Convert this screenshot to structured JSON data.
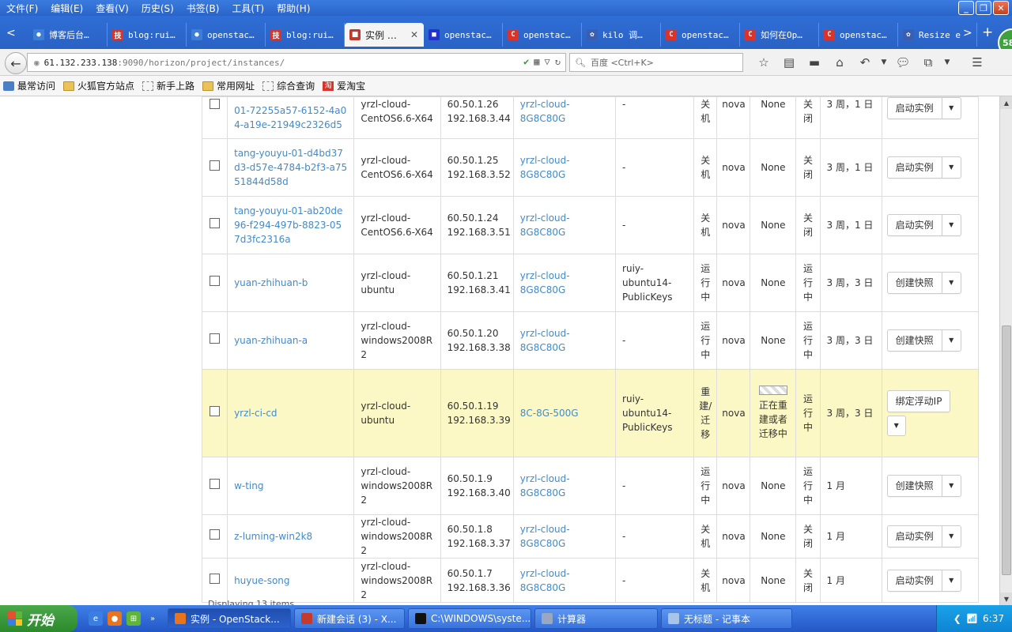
{
  "menu": [
    "文件(F)",
    "编辑(E)",
    "查看(V)",
    "历史(S)",
    "书签(B)",
    "工具(T)",
    "帮助(H)"
  ],
  "window_controls": {
    "minimize": "_",
    "maximize": "❐",
    "close": "✕"
  },
  "tabs": [
    {
      "label": "博客后台…",
      "icon_color": "#3d7fd6",
      "icon_char": "●"
    },
    {
      "label": "blog:rui…",
      "icon_color": "#d9342b",
      "icon_char": "技"
    },
    {
      "label": "openstac…",
      "icon_color": "#3d7fd6",
      "icon_char": "●"
    },
    {
      "label": "blog:rui…",
      "icon_color": "#d9342b",
      "icon_char": "技"
    },
    {
      "label": "实例 …",
      "icon_color": "#c0392b",
      "icon_char": "■",
      "active": true,
      "close": "✕"
    },
    {
      "label": "openstac…",
      "icon_color": "#2233cc",
      "icon_char": "■"
    },
    {
      "label": "openstac…",
      "icon_color": "#d9342b",
      "icon_char": "C"
    },
    {
      "label": "kilo 调…",
      "icon_color": "#3a5fb0",
      "icon_char": "✿"
    },
    {
      "label": "openstac…",
      "icon_color": "#d9342b",
      "icon_char": "C"
    },
    {
      "label": "如何在Op…",
      "icon_color": "#d9342b",
      "icon_char": "C"
    },
    {
      "label": "openstac…",
      "icon_color": "#d9342b",
      "icon_char": "C"
    },
    {
      "label": "Resize e",
      "icon_color": "#3a5fb0",
      "icon_char": "✿"
    }
  ],
  "tab_nav": {
    "prev": "<",
    "next": ">",
    "new": "+"
  },
  "profile_badge": "58",
  "url": {
    "host": "61.132.233.138",
    "rest": ":9090/horizon/project/instances/"
  },
  "search_placeholder": "百度 <Ctrl+K>",
  "bookmarks": [
    {
      "label": "最常访问",
      "icon": "search-icon"
    },
    {
      "label": "火狐官方站点",
      "icon": "folder-icon"
    },
    {
      "label": "新手上路",
      "icon": "dashed-page-icon"
    },
    {
      "label": "常用网址",
      "icon": "folder-icon"
    },
    {
      "label": "综合查询",
      "icon": "dashed-page-icon"
    },
    {
      "label": "爱淘宝",
      "icon": "taobao-icon"
    }
  ],
  "rows": [
    {
      "name": "01-72255a57-6152-4a04-a19e-21949c2326d5",
      "image": "yrzl-cloud-CentOS6.6-X64",
      "ip": "60.50.1.26 192.168.3.44",
      "flavor": "yrzl-cloud-8G8C80G",
      "keypair": "-",
      "status": "关机",
      "zone": "nova",
      "task": "None",
      "power": "关闭",
      "time": "3 周，1 日",
      "action": "启动实例",
      "partial_top": true
    },
    {
      "name": "tang-youyu-01-d4bd37d3-d57e-4784-b2f3-a7551844d58d",
      "image": "yrzl-cloud-CentOS6.6-X64",
      "ip": "60.50.1.25 192.168.3.52",
      "flavor": "yrzl-cloud-8G8C80G",
      "keypair": "-",
      "status": "关机",
      "zone": "nova",
      "task": "None",
      "power": "关闭",
      "time": "3 周，1 日",
      "action": "启动实例"
    },
    {
      "name": "tang-youyu-01-ab20de96-f294-497b-8823-057d3fc2316a",
      "image": "yrzl-cloud-CentOS6.6-X64",
      "ip": "60.50.1.24 192.168.3.51",
      "flavor": "yrzl-cloud-8G8C80G",
      "keypair": "-",
      "status": "关机",
      "zone": "nova",
      "task": "None",
      "power": "关闭",
      "time": "3 周，1 日",
      "action": "启动实例"
    },
    {
      "name": "yuan-zhihuan-b",
      "image": "yrzl-cloud-ubuntu",
      "ip": "60.50.1.21 192.168.3.41",
      "flavor": "yrzl-cloud-8G8C80G",
      "keypair": "ruiy-ubuntu14-PublicKeys",
      "status": "运行中",
      "zone": "nova",
      "task": "None",
      "power": "运行中",
      "time": "3 周，3 日",
      "action": "创建快照"
    },
    {
      "name": "yuan-zhihuan-a",
      "image": "yrzl-cloud-windows2008R2",
      "ip": "60.50.1.20 192.168.3.38",
      "flavor": "yrzl-cloud-8G8C80G",
      "keypair": "-",
      "status": "运行中",
      "zone": "nova",
      "task": "None",
      "power": "运行中",
      "time": "3 周，3 日",
      "action": "创建快照"
    },
    {
      "name": "yrzl-ci-cd",
      "image": "yrzl-cloud-ubuntu",
      "ip": "60.50.1.19 192.168.3.39",
      "flavor": "8C-8G-500G",
      "keypair": "ruiy-ubuntu14-PublicKeys",
      "status": "重建/迁移",
      "zone": "nova",
      "task": "正在重建或者迁移中",
      "power": "运行中",
      "time": "3 周，3 日",
      "action": "绑定浮动IP",
      "highlight": true
    },
    {
      "name": "w-ting",
      "image": "yrzl-cloud-windows2008R2",
      "ip": "60.50.1.9 192.168.3.40",
      "flavor": "yrzl-cloud-8G8C80G",
      "keypair": "-",
      "status": "运行中",
      "zone": "nova",
      "task": "None",
      "power": "运行中",
      "time": "1 月",
      "action": "创建快照"
    },
    {
      "name": "z-luming-win2k8",
      "image": "yrzl-cloud-windows2008R2",
      "ip": "60.50.1.8 192.168.3.37",
      "flavor": "yrzl-cloud-8G8C80G",
      "keypair": "-",
      "status": "关机",
      "zone": "nova",
      "task": "None",
      "power": "关闭",
      "time": "1 月",
      "action": "启动实例"
    },
    {
      "name": "huyue-song",
      "image": "yrzl-cloud-windows2008R2",
      "ip": "60.50.1.7 192.168.3.36",
      "flavor": "yrzl-cloud-8G8C80G",
      "keypair": "-",
      "status": "关机",
      "zone": "nova",
      "task": "None",
      "power": "关闭",
      "time": "1 月",
      "action": "启动实例"
    }
  ],
  "footer_note": "Displaying 13 items",
  "taskbar": {
    "start": "开始",
    "quicklaunch": [
      {
        "icon": "ie-icon",
        "color": "#3a7fe0",
        "char": "e"
      },
      {
        "icon": "firefox-icon",
        "color": "#e8741e",
        "char": "●"
      },
      {
        "icon": "windows-icon",
        "color": "#5fb43a",
        "char": "⊞"
      },
      {
        "icon": "more-icon",
        "color": "transparent",
        "char": "»"
      }
    ],
    "items": [
      {
        "label": "实例 - OpenStack...",
        "color": "#e8741e",
        "active": true
      },
      {
        "label": "新建会话 (3) - X...",
        "color": "#c43a2b"
      },
      {
        "label": "C:\\WINDOWS\\syste...",
        "color": "#111111"
      },
      {
        "label": "计算器",
        "color": "#9aa7c0"
      },
      {
        "label": "无标题 - 记事本",
        "color": "#a8c5e8"
      }
    ],
    "clock": "6:37"
  }
}
